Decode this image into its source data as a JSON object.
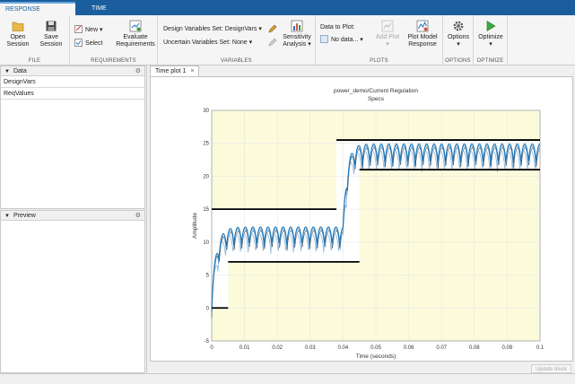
{
  "tabs": {
    "response_optimization": "RESPONSE OPTIMIZATION",
    "time_plot": "TIME PLOT"
  },
  "file": {
    "label": "FILE",
    "open_line1": "Open",
    "open_line2": "Session",
    "save_line1": "Save",
    "save_line2": "Session"
  },
  "requirements": {
    "label": "REQUIREMENTS",
    "new": "New",
    "select": "Select",
    "evaluate_line1": "Evaluate",
    "evaluate_line2": "Requirements"
  },
  "variables": {
    "label": "VARIABLES",
    "design_set": "Design Variables Set: DesignVars",
    "uncertain_set": "Uncertain Variables Set: None",
    "sensitivity_line1": "Sensitivity",
    "sensitivity_line2": "Analysis"
  },
  "plots": {
    "label": "PLOTS",
    "data_to_plot": "Data to Plot:",
    "no_data": "No data...",
    "add_plot": "Add Plot",
    "plot_model_line1": "Plot Model",
    "plot_model_line2": "Response"
  },
  "options": {
    "label": "OPTIONS",
    "button": "Options"
  },
  "optimize": {
    "label": "OPTIMIZE",
    "button": "Optimize"
  },
  "data_panel": {
    "title": "Data",
    "items": [
      "DesignVars",
      "ReqValues"
    ]
  },
  "preview_panel": {
    "title": "Preview"
  },
  "document": {
    "tab_label": "Time plot 1",
    "update_block": "Update block"
  },
  "colors": {
    "tab_strip": "#1b5e9e",
    "bound_fill": "#fbfbdc",
    "signal": "#1f77b4",
    "bound_line": "#000000"
  },
  "chart_data": {
    "type": "line",
    "title": "power_demo/Current  Regulation",
    "subtitle": "Specs",
    "xlabel": "Time (seconds)",
    "ylabel": "Amplitude",
    "xlim": [
      0,
      0.1
    ],
    "ylim": [
      -5,
      30
    ],
    "xticks": [
      0,
      0.01,
      0.02,
      0.03,
      0.04,
      0.05,
      0.06,
      0.07,
      0.08,
      0.09,
      0.1
    ],
    "yticks": [
      -5,
      0,
      5,
      10,
      15,
      20,
      25,
      30
    ],
    "grid": true,
    "upper_bound": [
      {
        "x": [
          0,
          0.038
        ],
        "y": [
          15,
          15
        ]
      },
      {
        "x": [
          0.038,
          0.1
        ],
        "y": [
          25.5,
          25.5
        ]
      }
    ],
    "lower_bound": [
      {
        "x": [
          0,
          0.005
        ],
        "y": [
          0,
          0
        ]
      },
      {
        "x": [
          0.005,
          0.045
        ],
        "y": [
          7,
          7
        ]
      },
      {
        "x": [
          0.045,
          0.1
        ],
        "y": [
          21,
          21
        ]
      }
    ],
    "signal": {
      "step1": {
        "start": 0.0,
        "level": 10.2,
        "ripple": 1.5
      },
      "step2": {
        "start": 0.04,
        "level": 22.7,
        "ripple": 1.6
      },
      "ripple_period": 0.0023
    }
  }
}
